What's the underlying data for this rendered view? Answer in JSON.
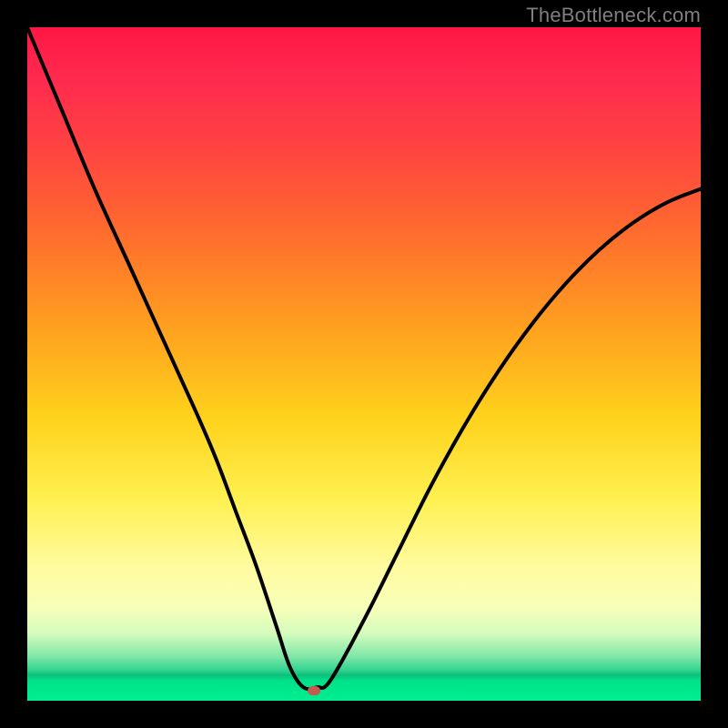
{
  "watermark": "TheBottleneck.com",
  "colors": {
    "frame": "#000000",
    "curve": "#000000",
    "dot": "#c55a4e",
    "gradient_stops": [
      "#ff1744",
      "#ff4341",
      "#ffa21f",
      "#fff050",
      "#f8ffb8",
      "#2fd38f",
      "#00ef90"
    ]
  },
  "chart_data": {
    "type": "line",
    "title": "",
    "xlabel": "",
    "ylabel": "",
    "xlim": [
      0,
      100
    ],
    "ylim": [
      0,
      100
    ],
    "grid": false,
    "legend": false,
    "annotations": [
      {
        "kind": "marker",
        "x": 42.5,
        "y": 1.5,
        "color": "#c55a4e"
      }
    ],
    "series": [
      {
        "name": "curve",
        "x": [
          0,
          5,
          10,
          15,
          20,
          25,
          28,
          31,
          34,
          37,
          39,
          41,
          43,
          45,
          50,
          55,
          60,
          65,
          70,
          75,
          80,
          85,
          90,
          95,
          100
        ],
        "values": [
          100,
          88,
          76,
          65,
          54,
          43,
          36,
          28,
          20,
          11,
          5,
          2,
          2,
          3,
          12,
          22,
          32,
          41,
          49,
          56,
          62,
          67,
          71,
          74,
          76
        ]
      }
    ]
  }
}
